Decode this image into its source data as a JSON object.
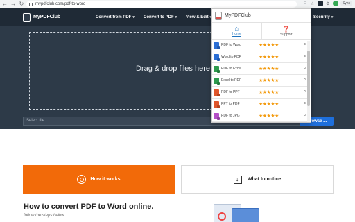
{
  "browser": {
    "url": "mypdfclub.com/pdf-to-word",
    "sync_label": "Sync",
    "back": "←",
    "forward": "→",
    "reload": "↻"
  },
  "site": {
    "logo_text": "MyPDFClub",
    "nav": [
      {
        "label": "Convert from PDF"
      },
      {
        "label": "Convert to PDF"
      },
      {
        "label": "View & Edit"
      },
      {
        "label": "Security"
      }
    ]
  },
  "hero": {
    "drop_text": "Drag & drop files here",
    "select_placeholder": "Select file ...",
    "browse_label": "Browse ..."
  },
  "popup": {
    "title": "MyPDFClub",
    "tabs": [
      {
        "label": "Home",
        "icon": "home-icon"
      },
      {
        "label": "Support",
        "icon": "help-icon"
      }
    ],
    "tools": [
      {
        "name": "PDF to Word",
        "color": "#2b6fd6",
        "stars": "★★★★★"
      },
      {
        "name": "Word to PDF",
        "color": "#2b6fd6",
        "stars": "★★★★★"
      },
      {
        "name": "PDF to Excel",
        "color": "#2e9b4e",
        "stars": "★★★★★"
      },
      {
        "name": "Excel to PDF",
        "color": "#2e9b4e",
        "stars": "★★★★★"
      },
      {
        "name": "PDF to PPT",
        "color": "#e0562b",
        "stars": "★★★★★"
      },
      {
        "name": "PPT to PDF",
        "color": "#e0562b",
        "stars": "★★★★★"
      },
      {
        "name": "PDF to JPG",
        "color": "#b44fc8",
        "stars": "★★★★★"
      }
    ]
  },
  "lower": {
    "how_label": "How it works",
    "notice_label": "What to notice",
    "title": "How to convert PDF to Word online.",
    "subtitle": "follow the steps below."
  },
  "colors": {
    "header_bg": "#1f2a36",
    "hero_bg": "#2d3a48",
    "accent_orange": "#f26a09",
    "browse_blue": "#1e6fdc",
    "star_orange": "#f39c12"
  }
}
